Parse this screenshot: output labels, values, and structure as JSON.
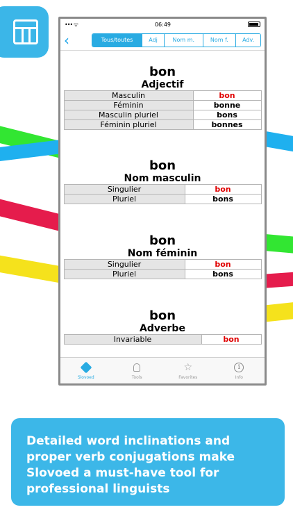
{
  "colors": {
    "accent": "#29abe2",
    "caption_bg": "#3cb7e8",
    "red_value": "#e00000",
    "ribbon_green": "#32e632",
    "ribbon_blue": "#1fb0ef",
    "ribbon_red": "#e51c4c",
    "ribbon_yellow": "#f5e21c"
  },
  "status_bar": {
    "signal": "••• ᯤ",
    "time": "06:49"
  },
  "toolbar": {
    "back_icon": "chevron-left-icon",
    "back_glyph": "‹",
    "tabs": [
      {
        "label": "Tous/toutes",
        "active": true
      },
      {
        "label": "Adj",
        "active": false
      },
      {
        "label": "Nom m.",
        "active": false
      },
      {
        "label": "Nom f.",
        "active": false
      },
      {
        "label": "Adv.",
        "active": false
      }
    ]
  },
  "entries": [
    {
      "headword": "bon",
      "pos": "Adjectif",
      "rows": [
        {
          "label": "Masculin",
          "value": "bon",
          "red": true
        },
        {
          "label": "Féminin",
          "value": "bonne",
          "red": false
        },
        {
          "label": "Masculin pluriel",
          "value": "bons",
          "red": false
        },
        {
          "label": "Féminin pluriel",
          "value": "bonnes",
          "red": false
        }
      ]
    },
    {
      "headword": "bon",
      "pos": "Nom masculin",
      "rows": [
        {
          "label": "Singulier",
          "value": "bon",
          "red": true
        },
        {
          "label": "Pluriel",
          "value": "bons",
          "red": false
        }
      ]
    },
    {
      "headword": "bon",
      "pos": "Nom féminin",
      "rows": [
        {
          "label": "Singulier",
          "value": "bon",
          "red": true
        },
        {
          "label": "Pluriel",
          "value": "bons",
          "red": false
        }
      ]
    },
    {
      "headword": "bon",
      "pos": "Adverbe",
      "rows": [
        {
          "label": "Invariable",
          "value": "bon",
          "red": true
        }
      ]
    }
  ],
  "tabbar": [
    {
      "label": "Slovoed",
      "icon": "slovoed-diamond-icon",
      "active": true
    },
    {
      "label": "Tools",
      "icon": "lightbulb-icon",
      "active": false
    },
    {
      "label": "Favorites",
      "icon": "star-icon",
      "active": false
    },
    {
      "label": "Info",
      "icon": "info-icon",
      "active": false
    }
  ],
  "caption": "Detailed word inclinations and proper verb conjugations make Slovoed a must-have tool for professional linguists",
  "app_icon": "table-grid-icon"
}
